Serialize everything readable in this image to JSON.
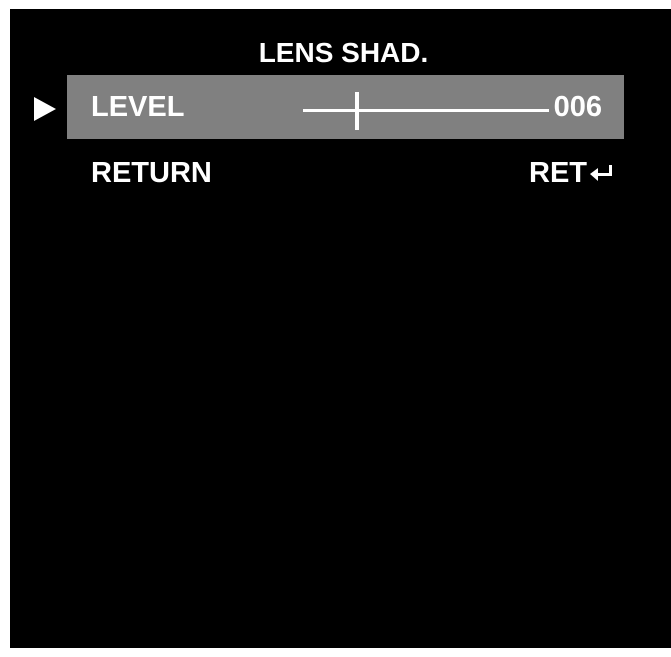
{
  "menu": {
    "title": "LENS SHAD.",
    "items": [
      {
        "label": "LEVEL",
        "value": "006",
        "selected": true,
        "slider_position": 0.22
      },
      {
        "label": "RETURN",
        "value": "RET"
      }
    ],
    "cursor_icon": "triangle-right-icon",
    "return_icon": "enter-return-icon"
  },
  "colors": {
    "background": "#000000",
    "selected_row": "#808080",
    "text": "#ffffff"
  }
}
